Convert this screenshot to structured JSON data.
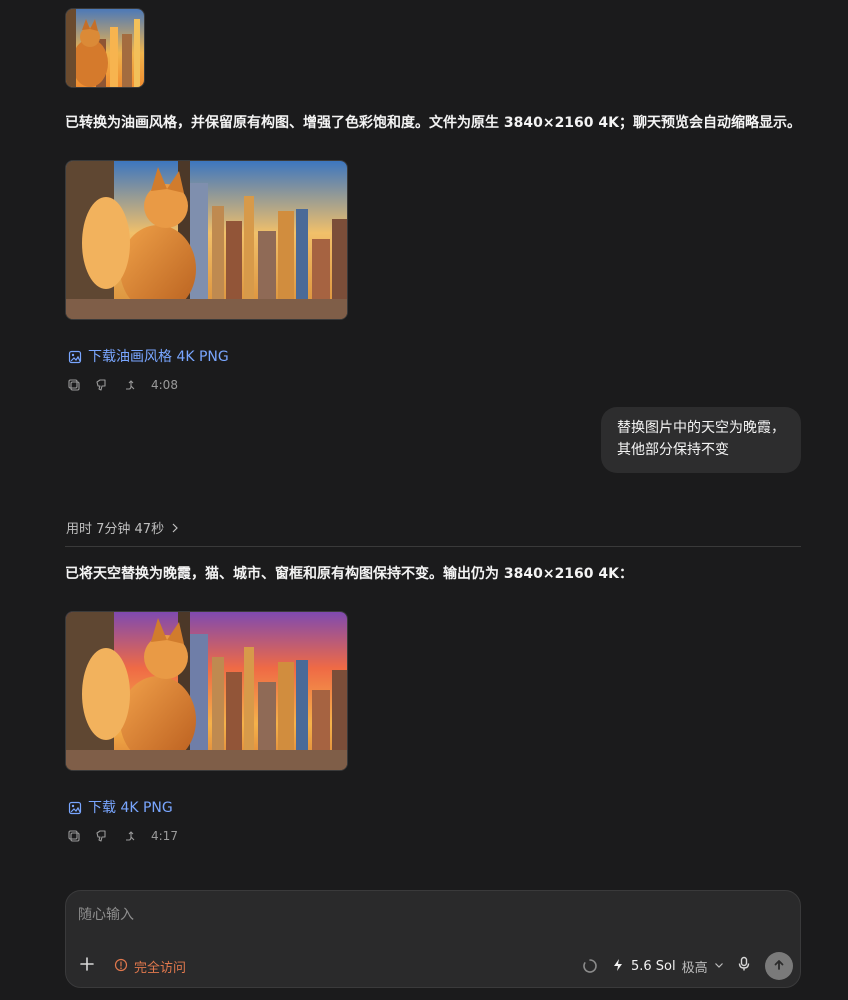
{
  "thread": {
    "message_1": {
      "text": "已转换为油画风格，并保留原有构图、增强了色彩饱和度。文件为原生 3840×2160 4K；聊天预览会自动缩略显示。",
      "download_label": "下载油画风格 4K PNG",
      "time": "4:08"
    },
    "user_message": {
      "line_1": "替换图片中的天空为晚霞，",
      "line_2": "其他部分保持不变"
    },
    "duration": {
      "label": "用时 7分钟 47秒"
    },
    "message_2": {
      "text": "已将天空替换为晚霞，猫、城市、窗框和原有构图保持不变。输出仍为 3840×2160 4K：",
      "download_label": "下载 4K PNG",
      "time": "4:17"
    }
  },
  "composer": {
    "placeholder": "随心输入",
    "access_label": "完全访问",
    "model": "5.6 Sol",
    "level": "极高"
  },
  "icons": {
    "image": "image-icon",
    "copy": "copy-icon",
    "thumbs_down": "thumbs-down-icon",
    "branch": "branch-icon",
    "chevron_right": "chevron-right-icon",
    "plus": "plus-icon",
    "warning": "warning-icon",
    "loading": "loading-icon",
    "bolt": "bolt-icon",
    "chevron_down": "chevron-down-icon",
    "microphone": "microphone-icon",
    "arrow_up": "arrow-up-icon"
  },
  "colors": {
    "background": "#1b1b1c",
    "text": "#f4f4f4",
    "link": "#79a6ff",
    "muted": "#9a9a9a",
    "warning": "#e0784d",
    "bubble": "#2d2d2e",
    "composer": "#2a2a2b"
  }
}
